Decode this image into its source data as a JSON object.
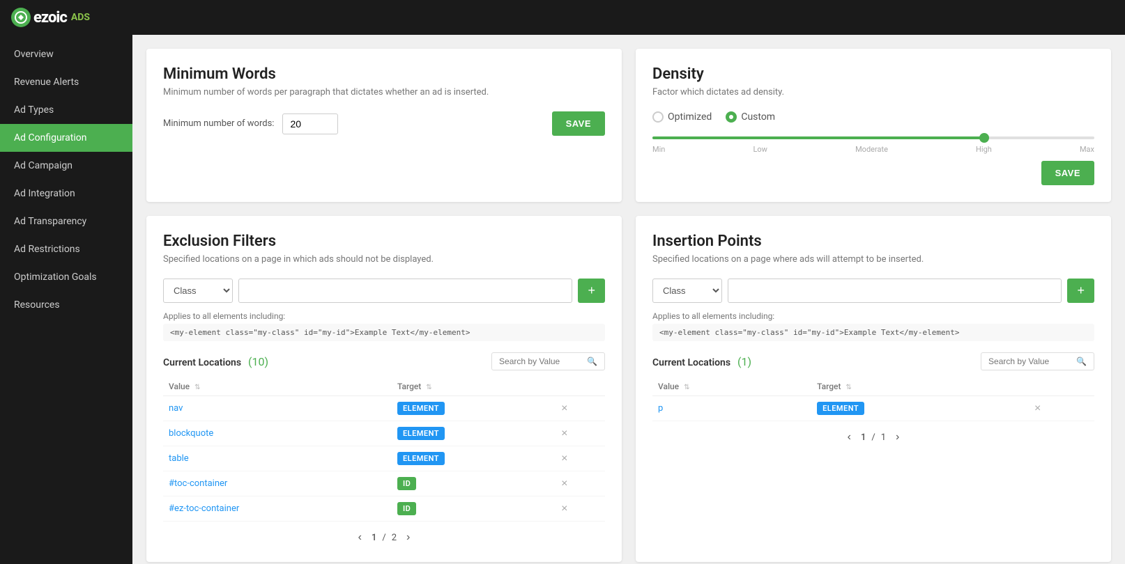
{
  "header": {
    "logo_letter": "e",
    "logo_main": "ezoic",
    "logo_sub": "ADS"
  },
  "sidebar": {
    "items": [
      {
        "label": "Overview",
        "active": false
      },
      {
        "label": "Revenue Alerts",
        "active": false
      },
      {
        "label": "Ad Types",
        "active": false
      },
      {
        "label": "Ad Configuration",
        "active": true
      },
      {
        "label": "Ad Campaign",
        "active": false
      },
      {
        "label": "Ad Integration",
        "active": false
      },
      {
        "label": "Ad Transparency",
        "active": false
      },
      {
        "label": "Ad Restrictions",
        "active": false
      },
      {
        "label": "Optimization Goals",
        "active": false
      },
      {
        "label": "Resources",
        "active": false
      }
    ]
  },
  "minimum_words": {
    "title": "Minimum Words",
    "desc": "Minimum number of words per paragraph that dictates whether an ad is inserted.",
    "label": "Minimum number of words:",
    "value": "20",
    "save_label": "SAVE"
  },
  "density": {
    "title": "Density",
    "desc": "Factor which dictates ad density.",
    "options": [
      "Optimized",
      "Custom"
    ],
    "selected": "Custom",
    "slider_labels": [
      "Min",
      "Low",
      "Moderate",
      "High",
      "Max"
    ],
    "slider_value": 75,
    "save_label": "SAVE"
  },
  "exclusion_filters": {
    "title": "Exclusion Filters",
    "desc": "Specified locations on a page in which ads should not be displayed.",
    "select_value": "Class",
    "applies_label": "Applies to all elements including:",
    "code_example": "<my-element class=\"my-class\" id=\"my-id\">Example Text</my-element>",
    "add_btn": "+",
    "current_locations_label": "Current Locations",
    "count": "(10)",
    "search_placeholder": "Search by Value",
    "columns": [
      "Value",
      "Target"
    ],
    "rows": [
      {
        "value": "nav",
        "target": "ELEMENT",
        "target_type": "element"
      },
      {
        "value": "blockquote",
        "target": "ELEMENT",
        "target_type": "element"
      },
      {
        "value": "table",
        "target": "ELEMENT",
        "target_type": "element"
      },
      {
        "value": "#toc-container",
        "target": "ID",
        "target_type": "id"
      },
      {
        "value": "#ez-toc-container",
        "target": "ID",
        "target_type": "id"
      }
    ],
    "page_current": "1",
    "page_total": "2"
  },
  "insertion_points": {
    "title": "Insertion Points",
    "desc": "Specified locations on a page where ads will attempt to be inserted.",
    "select_value": "Class",
    "applies_label": "Applies to all elements including:",
    "code_example": "<my-element class=\"my-class\" id=\"my-id\">Example Text</my-element>",
    "add_btn": "+",
    "current_locations_label": "Current Locations",
    "count": "(1)",
    "search_placeholder": "Search by Value",
    "columns": [
      "Value",
      "Target"
    ],
    "rows": [
      {
        "value": "p",
        "target": "ELEMENT",
        "target_type": "element"
      }
    ],
    "page_current": "1",
    "page_total": "1"
  }
}
